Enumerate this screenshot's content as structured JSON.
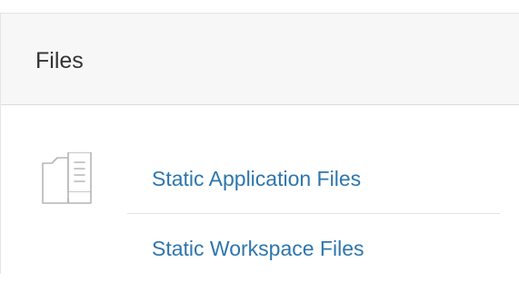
{
  "region": {
    "title": "Files",
    "icon": "files-icon",
    "links": [
      {
        "label": "Static Application Files"
      },
      {
        "label": "Static Workspace Files"
      }
    ]
  },
  "colors": {
    "link": "#2e76ad",
    "header_bg": "#f7f7f7",
    "title": "#333333",
    "icon_stroke": "#b5b5b5"
  }
}
